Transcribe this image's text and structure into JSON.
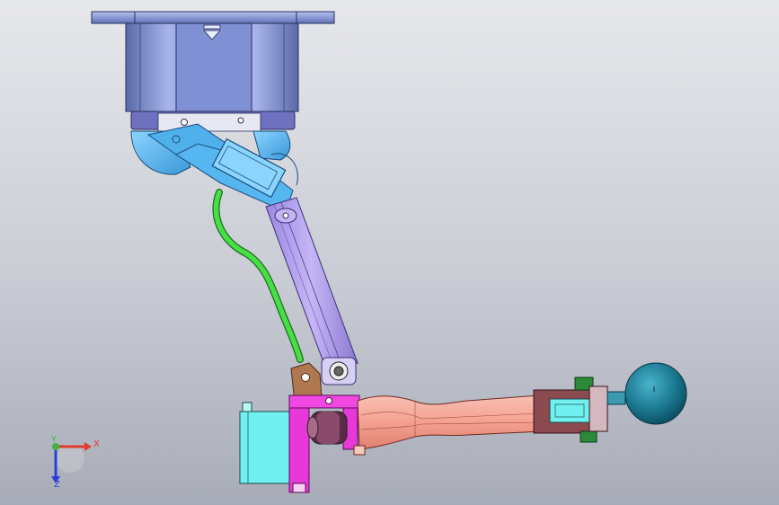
{
  "scene": {
    "title": "",
    "background_top": "#e7e8ec",
    "background_bottom": "#a8acb8"
  },
  "triad": {
    "x_label": "X",
    "y_label": "Y",
    "z_label": "Z",
    "x_color": "#e23a2e",
    "y_color": "#3fb43f",
    "z_color": "#2b3fd8"
  },
  "colors": {
    "flange": "#7e8ed0",
    "housing": "#8f9ee0",
    "motor_blue": "#5ab8f0",
    "purple_link": "#b4a0ee",
    "green_cable": "#40e040",
    "brown_bracket": "#b07850",
    "magenta_frame": "#e838d8",
    "cyan_box": "#70f0f0",
    "salmon_arm": "#f4a090",
    "dark_housing": "#8a4a50",
    "teal_ball": "#1a7890"
  }
}
